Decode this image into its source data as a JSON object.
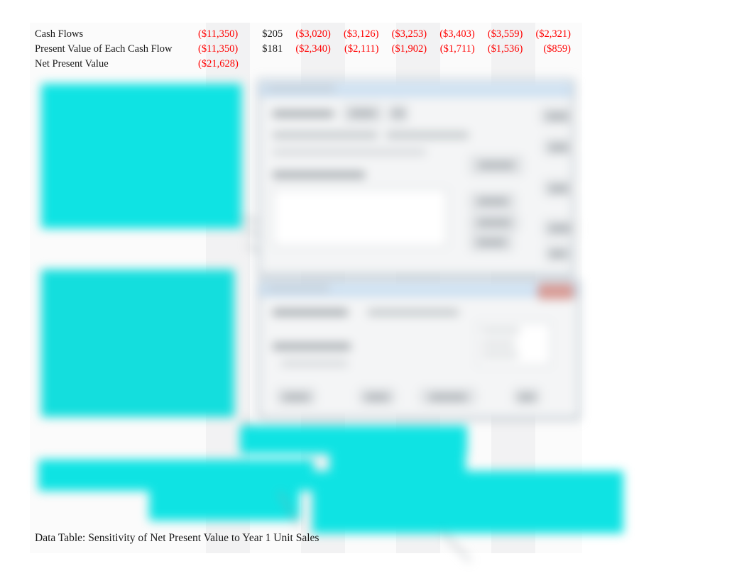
{
  "sheet": {
    "rows": [
      {
        "label": "Cash Flows",
        "values": [
          "($11,350)",
          "$205",
          "($3,020)",
          "($3,126)",
          "($3,253)",
          "($3,403)",
          "($3,559)",
          "($2,321)"
        ],
        "signs": [
          "neg",
          "pos",
          "neg",
          "neg",
          "neg",
          "neg",
          "neg",
          "neg"
        ]
      },
      {
        "label": "Present Value of Each Cash Flow",
        "values": [
          "($11,350)",
          "$181",
          "($2,340)",
          "($2,111)",
          "($1,902)",
          "($1,711)",
          "($1,536)",
          "($859)"
        ],
        "signs": [
          "neg",
          "pos",
          "neg",
          "neg",
          "neg",
          "neg",
          "neg",
          "neg"
        ]
      },
      {
        "label": "Net Present Value",
        "values": [
          "($21,628)",
          "",
          "",
          "",
          "",
          "",
          "",
          ""
        ],
        "signs": [
          "neg",
          "pos",
          "pos",
          "pos",
          "pos",
          "pos",
          "pos",
          "pos"
        ]
      }
    ]
  },
  "caption": {
    "text": "Data Table: Sensitivity of Net Present Value to Year 1 Unit Sales"
  },
  "colors": {
    "negative": "#ff0000",
    "positive": "#1a1a1a",
    "selection_cyan": "#0fe3e3",
    "dialog_titlebar": "#cfe2f3",
    "close_button": "#d89b95",
    "sheet_background": "#fbfbfb"
  },
  "dialogs": [
    {
      "name": "data-table-dialog",
      "title": "",
      "close_label": ""
    },
    {
      "name": "sensitivity-dialog",
      "title": "",
      "close_label": ""
    }
  ]
}
